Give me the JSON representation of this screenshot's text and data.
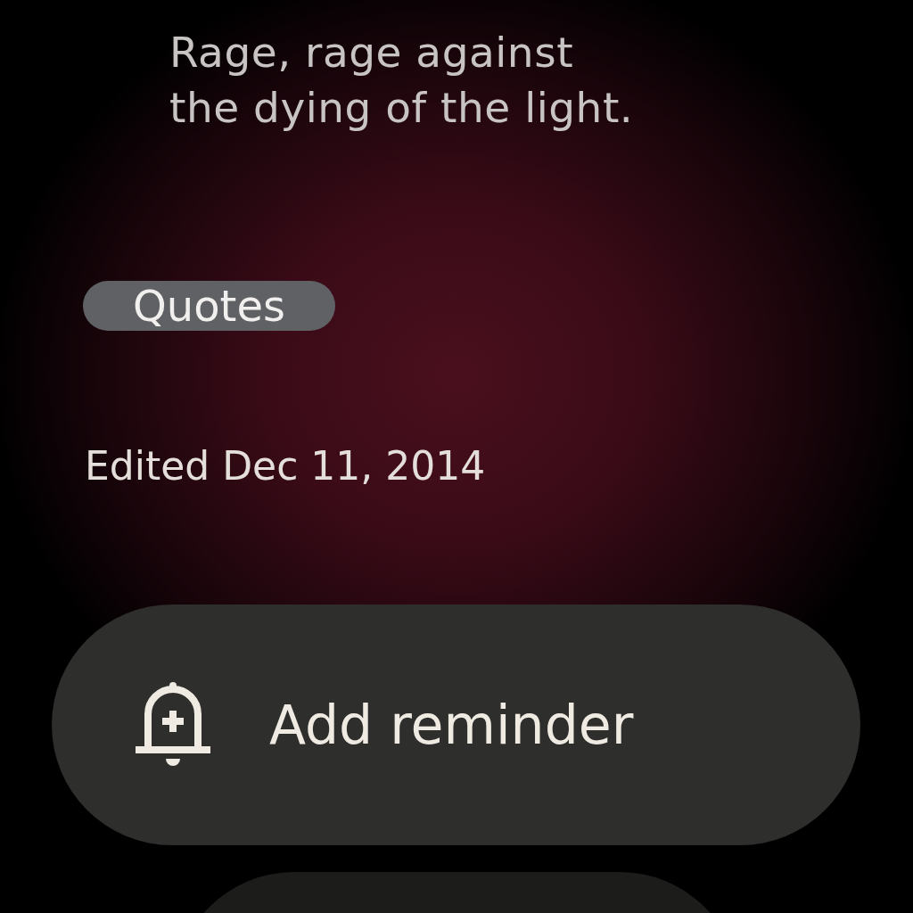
{
  "note": {
    "lines": [
      "Rage, rage against",
      "the dying of the light."
    ]
  },
  "label": "Quotes",
  "edited": "Edited Dec 11, 2014",
  "actions": [
    {
      "label": "Add reminder",
      "kind": "reminder"
    },
    {
      "kind": "blank"
    }
  ]
}
